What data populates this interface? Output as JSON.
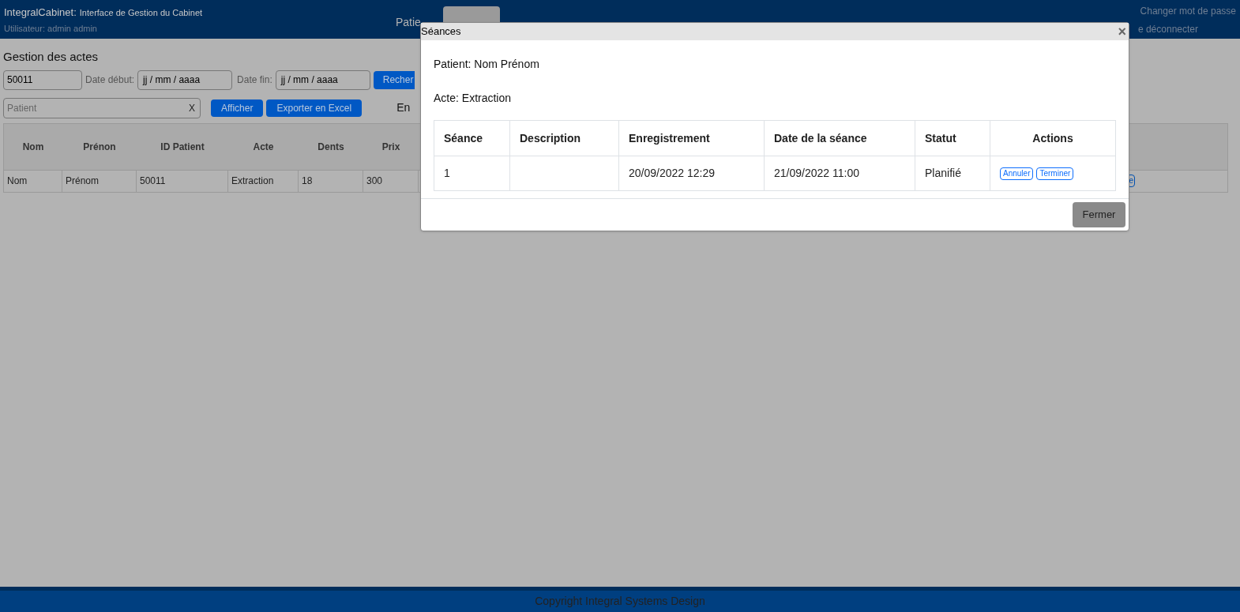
{
  "header": {
    "app_name": "IntegralCabinet:",
    "subtitle": "Interface de Gestion du Cabinet",
    "user": "Utilisateur: admin admin",
    "change_password": "Changer mot de passe",
    "logout": "e déconnecter"
  },
  "nav_tabs": [
    {
      "label": "Patie",
      "selected": false
    },
    {
      "selected": true
    }
  ],
  "page": {
    "title": "Gestion des actes",
    "id_field": {
      "value": "50011"
    },
    "start_label": "Date début:",
    "start_field": {
      "value": "jj / mm / aaaa"
    },
    "end_label": "Date fin:",
    "end_field": {
      "value": "jj / mm / aaaa"
    },
    "search_button": "Recher",
    "patient_field": {
      "placeholder": "Patient",
      "clear": "X"
    },
    "show_button": "Afficher",
    "export_button": "Exporter en Excel",
    "status_text": "En"
  },
  "table": {
    "columns": [
      "Nom",
      "Prénon",
      "ID Patient",
      "Acte",
      "Dents",
      "Prix"
    ],
    "rows": [
      {
        "cells": [
          "Nom",
          "Prénom",
          "50011",
          "Extraction",
          "18",
          "300"
        ],
        "action": "e"
      }
    ]
  },
  "modal": {
    "title": "Séances",
    "close": "×",
    "patient": "Patient: Nom Prénom",
    "act": "Acte: Extraction",
    "columns": [
      "Séance",
      "Description",
      "Enregistrement",
      "Date de la séance",
      "Statut",
      "Actions"
    ],
    "rows": [
      {
        "cells": [
          "1",
          "",
          "20/09/2022 12:29",
          "21/09/2022 11:00",
          "Planifié"
        ],
        "actions": [
          "Annuler",
          "Terminer"
        ]
      }
    ],
    "footer_button": "Fermer"
  },
  "footer": {
    "text": "Copyright Integral Systems Design"
  }
}
